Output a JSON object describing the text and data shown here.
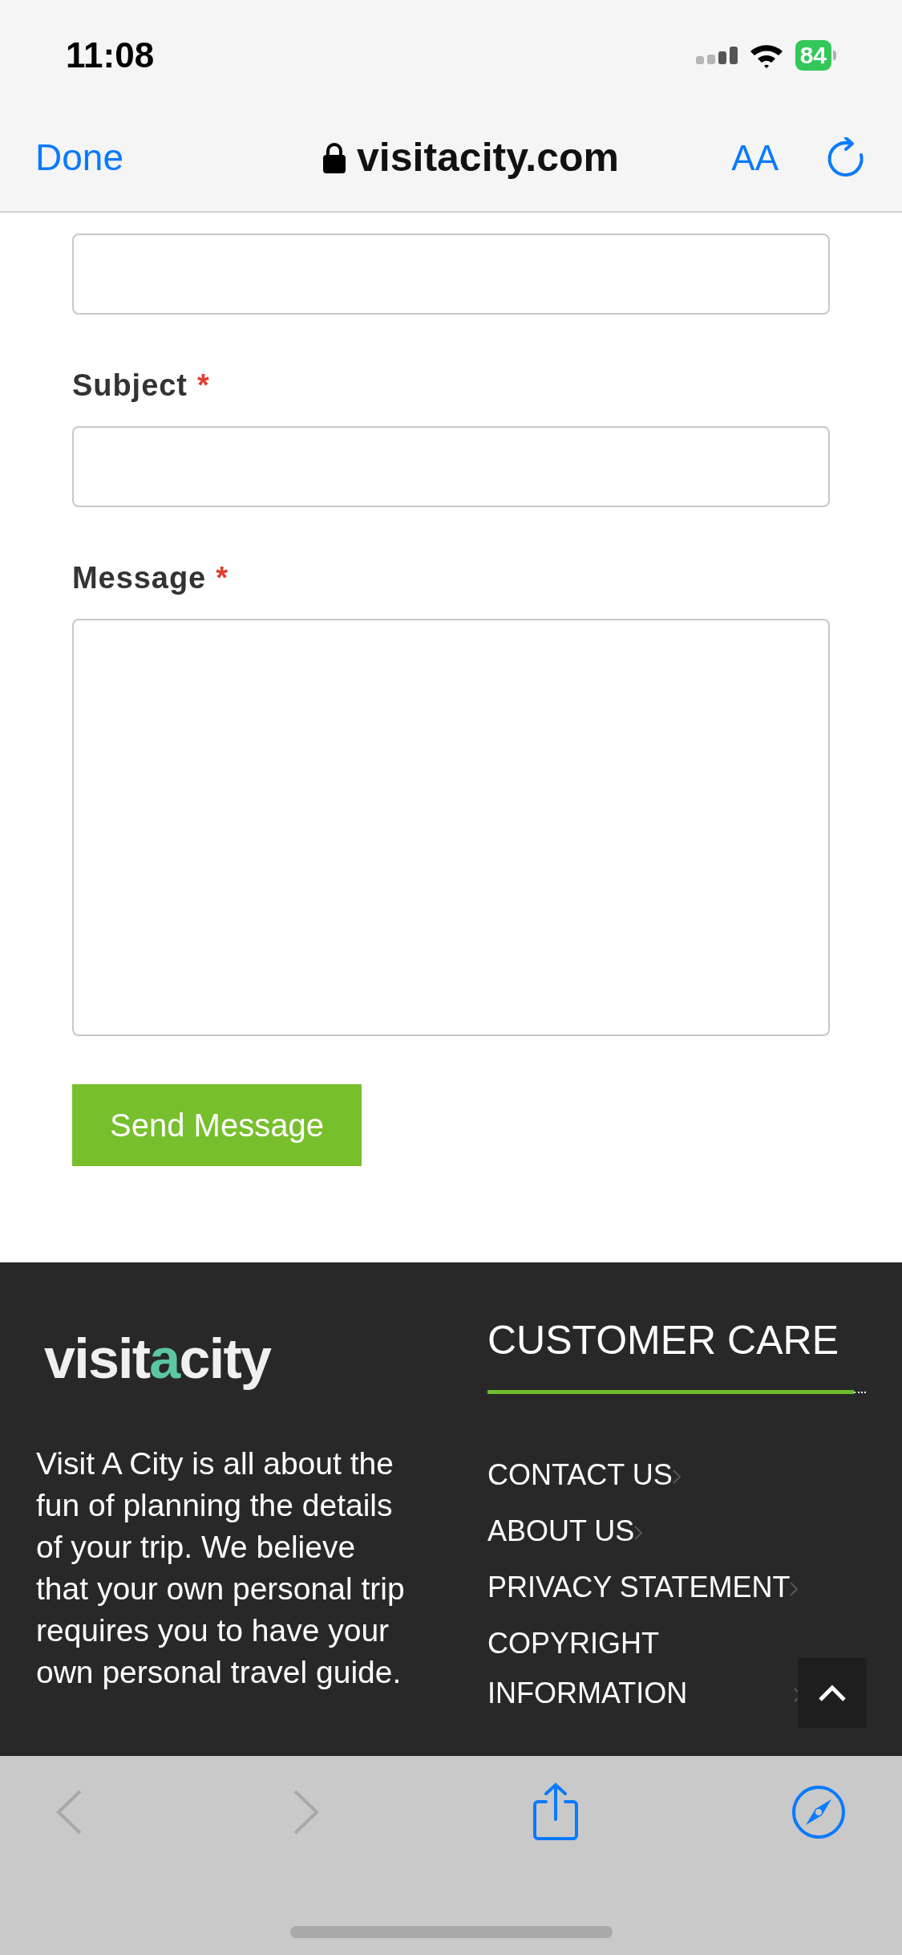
{
  "status_bar": {
    "time": "11:08",
    "battery": "84"
  },
  "browser": {
    "done": "Done",
    "url": "visitacity.com",
    "text_size": "AA"
  },
  "form": {
    "fields": [
      {
        "kind": "input"
      },
      {
        "kind": "input",
        "label": "Subject",
        "required": "*"
      },
      {
        "kind": "textarea",
        "label": "Message",
        "required": "*"
      }
    ],
    "submit": "Send Message"
  },
  "footer": {
    "logo": [
      "visit",
      "a",
      "city"
    ],
    "about": "Visit A City is all about the fun of planning the details of your trip. We believe that your own personal trip requires you to have your own personal travel guide.",
    "section_title": "CUSTOMER CARE",
    "links": [
      "CONTACT US",
      "ABOUT US",
      "PRIVACY STATEMENT",
      "COPYRIGHT INFORMATION"
    ]
  }
}
